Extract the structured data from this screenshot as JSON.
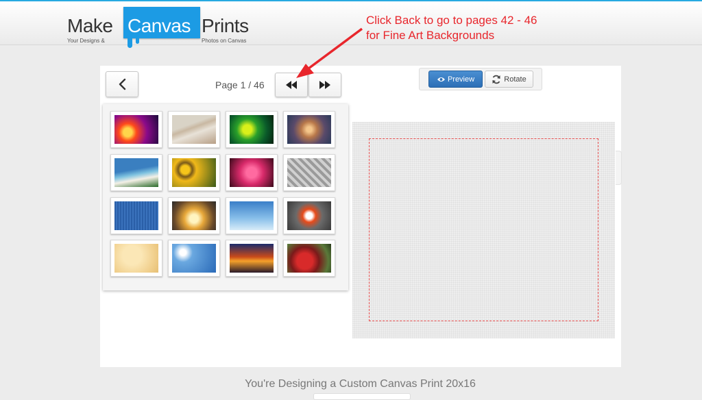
{
  "logo": {
    "make": "Make",
    "canvas": "Canvas",
    "prints": "Prints",
    "tagline_left": "Your Designs &",
    "tagline_right": "Photos on Canvas"
  },
  "annotation": {
    "line1": "Click Back to go to pages 42 - 46",
    "line2": "for Fine Art Backgrounds",
    "color": "#e8262c"
  },
  "pager": {
    "label": "Page 1 / 46",
    "back_icon": "chevron-left-icon",
    "rewind_icon": "fast-backward-icon",
    "forward_icon": "fast-forward-icon"
  },
  "toolbar": {
    "preview_label": "Preview",
    "rotate_label": "Rotate",
    "preview_icon": "eye-icon",
    "rotate_icon": "refresh-icon",
    "accent": "#2d6fb6"
  },
  "gallery": {
    "thumbnails": [
      {
        "name": "thumb-abstract-light",
        "bg": "radial-gradient(circle at 30% 60%, #ffd54a 0 12%, #ff4a1a 25%, #8a0a8a 55%, #1a0a3a 100%)"
      },
      {
        "name": "thumb-beach-shore",
        "bg": "linear-gradient(160deg, #d9d3c6 0 35%, #c9b8a2 45%, #e8e2d8 60%, #b79f86 100%)"
      },
      {
        "name": "thumb-green-mosaic",
        "bg": "radial-gradient(circle at 40% 50%, #d9f01a 0 15%, #2aa02a 35%, #0a5a2a 65%, #06200e 100%)"
      },
      {
        "name": "thumb-swirl",
        "bg": "radial-gradient(circle at 50% 50%, #f4c58a 0 10%, #b8784a 30%, #5a4a6a 60%, #2a3a5a 100%)"
      },
      {
        "name": "thumb-tropical-beach",
        "bg": "linear-gradient(170deg, #3a7fc0 0 40%, #7fc3e0 55%, #f4f0e6 70%, #2a6a2a 100%)"
      },
      {
        "name": "thumb-sunflowers",
        "bg": "radial-gradient(circle at 30% 40%, #f6c51a 0 12%, #7a5a1a 20%, #f0b81a 32%, #3a5a1a 100%)"
      },
      {
        "name": "thumb-pink-hearts",
        "bg": "radial-gradient(circle at 50% 50%, #ff6aa0 0 20%, #d82a6a 45%, #3a0a1a 100%)"
      },
      {
        "name": "thumb-diamond-plate",
        "bg": "repeating-linear-gradient(45deg, #9a9a9a 0 4px, #d0d0d0 4px 8px)"
      },
      {
        "name": "thumb-blue-denim",
        "bg": "repeating-linear-gradient(90deg, #2a5fa8 0 2px, #3a72bc 2px 4px)"
      },
      {
        "name": "thumb-heart-hands",
        "bg": "radial-gradient(circle at 50% 60%, #fff4c0 0 15%, #e8a83a 35%, #6a4a2a 70%, #2a2a2a 100%)"
      },
      {
        "name": "thumb-jets-sky",
        "bg": "linear-gradient(180deg, #3a7fc8 0%, #8ac0ea 60%, #d8ecf8 100%)"
      },
      {
        "name": "thumb-splash-ball",
        "bg": "radial-gradient(circle at 50% 50%, #ffffff 0 12%, #e84a1a 25%, #6a6a6a 50%, #3a3a3a 100%)"
      },
      {
        "name": "thumb-parchment",
        "bg": "radial-gradient(circle at 40% 40%, #fbe7b6 0 30%, #f1d08e 70%, #e6bf74 100%)"
      },
      {
        "name": "thumb-sun-clouds",
        "bg": "radial-gradient(circle at 25% 30%, #ffffff 0 8%, #6aa8e0 25%, #2a6ab8 100%)"
      },
      {
        "name": "thumb-sunset",
        "bg": "linear-gradient(180deg, #1a2a6a 0%, #c84a1a 45%, #f5a02a 60%, #2a1a2a 100%)"
      },
      {
        "name": "thumb-red-car",
        "bg": "radial-gradient(circle at 40% 60%, #d82a2a 0 25%, #7a1a1a 45%, #5a7a3a 75%, #2a3a1a 100%)"
      }
    ]
  },
  "footer": {
    "text": "You're Designing a Custom Canvas Print 20x16"
  }
}
